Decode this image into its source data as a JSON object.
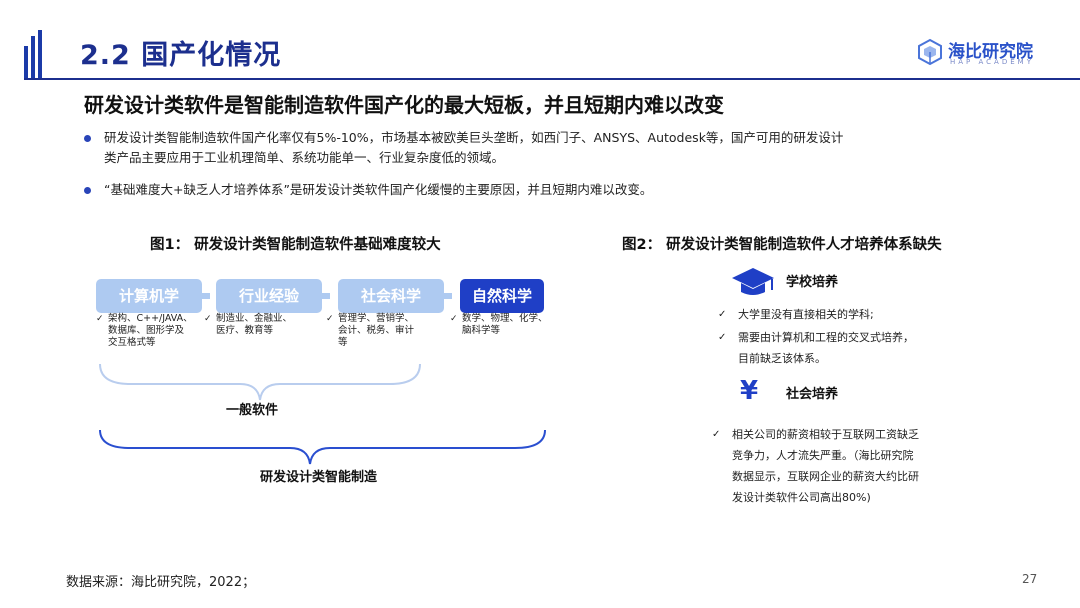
{
  "header": {
    "title": "2.2 国产化情况",
    "logo": {
      "name": "海比研究院",
      "sub": "HAP ACADEMY"
    }
  },
  "subtitle": "研发设计类软件是智能制造软件国产化的最大短板，并且短期内难以改变",
  "bullets": [
    {
      "line1": "研发设计类智能制造软件国产化率仅有5%-10%，市场基本被欧美巨头垄断，如西门子、ANSYS、Autodesk等，国产可用的研发设计",
      "line2": "类产品主要应用于工业机理简单、系统功能单一、行业复杂度低的领域。"
    },
    {
      "line1": "“基础难度大+缺乏人才培养体系”是研发设计类软件国产化缓慢的主要原因，并且短期内难以改变。"
    }
  ],
  "figure1": {
    "title": "图1：  研发设计类智能制造软件基础难度较大",
    "boxes": [
      {
        "label": "计算机学",
        "items": [
          "架构、C++/JAVA、",
          "数据库、图形学及",
          "交互格式等"
        ]
      },
      {
        "label": "行业经验",
        "items": [
          "制造业、金融业、",
          "医疗、教育等"
        ]
      },
      {
        "label": "社会科学",
        "items": [
          "管理学、营销学、",
          "会计、税务、审计",
          "等"
        ]
      },
      {
        "label": "自然科学",
        "items": [
          "数学、物理、化学、",
          "脑科学等"
        ]
      }
    ],
    "brace1_label": "一般软件",
    "brace2_label": "研发设计类智能制造",
    "check": "✓"
  },
  "figure2": {
    "title": "图2：  研发设计类智能制造软件人才培养体系缺失",
    "section1": {
      "title": "学校培养",
      "icon": "graduation-cap-icon",
      "items": [
        "大学里没有直接相关的学科;",
        "需要由计算机和工程的交叉式培养，",
        "目前缺乏该体系。"
      ]
    },
    "section2": {
      "title": "社会培养",
      "icon": "yen-icon",
      "icon_glyph": "¥",
      "lines": [
        "相关公司的薪资相较于互联网工资缺乏",
        "竞争力，人才流失严重。（海比研究院",
        "数据显示，互联网企业的薪资大约比研",
        "发设计类软件公司高出80%)"
      ]
    },
    "check": "✓"
  },
  "footer": {
    "source": "数据来源：海比研究院，2022；",
    "page": "27"
  },
  "colors": {
    "primary": "#1c2f8e",
    "accent": "#1f3fc6",
    "light": "#aecaf1",
    "brace": "#2a4fd0"
  }
}
